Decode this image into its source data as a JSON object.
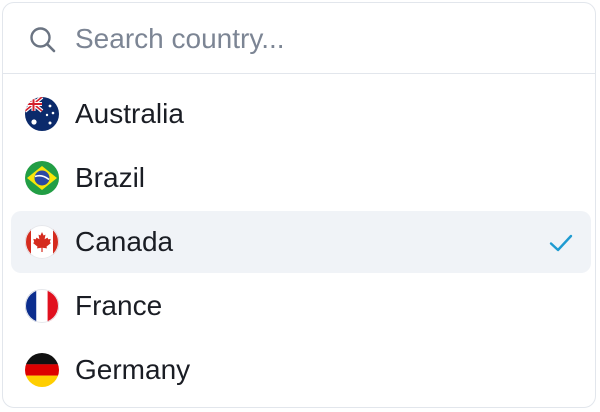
{
  "search": {
    "placeholder": "Search country..."
  },
  "countries": [
    {
      "label": "Australia",
      "flag": "australia-flag-icon",
      "selected": false
    },
    {
      "label": "Brazil",
      "flag": "brazil-flag-icon",
      "selected": false
    },
    {
      "label": "Canada",
      "flag": "canada-flag-icon",
      "selected": true
    },
    {
      "label": "France",
      "flag": "france-flag-icon",
      "selected": false
    },
    {
      "label": "Germany",
      "flag": "germany-flag-icon",
      "selected": false
    }
  ],
  "colors": {
    "check": "#1f9bd1",
    "selected_bg": "#f0f3f7",
    "border": "#e2e6ec"
  }
}
